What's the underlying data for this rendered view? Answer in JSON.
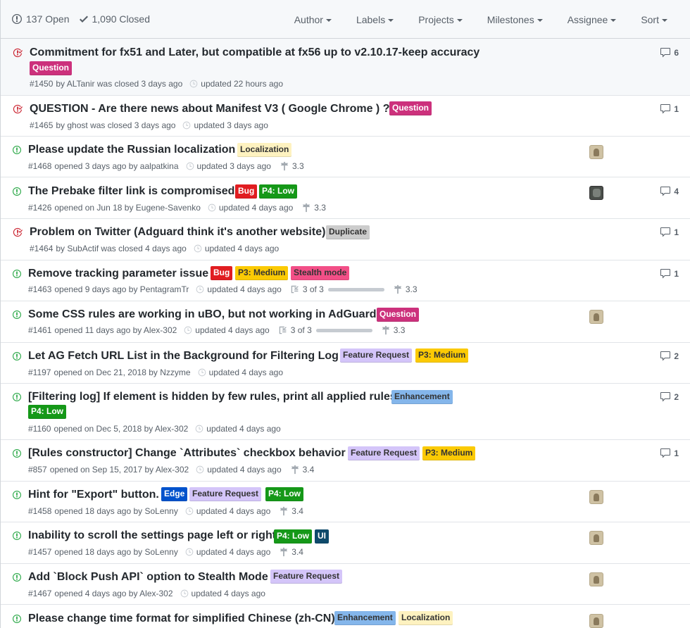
{
  "header": {
    "open_label": "137 Open",
    "closed_label": "1,090 Closed",
    "filters": [
      "Author",
      "Labels",
      "Projects",
      "Milestones",
      "Assignee",
      "Sort"
    ]
  },
  "colors": {
    "open_icon": "#28a745",
    "closed_icon": "#cb2431",
    "meta_text": "#586069"
  },
  "issues": [
    {
      "title": "Commitment for fx51 and Later, but compatible at fx56 up to v2.10.17-keep accuracy",
      "labels": [
        {
          "name": "Question",
          "bg": "#cc317c",
          "fg": "#ffffff"
        }
      ],
      "number": "#1450",
      "meta_main": "by ALTanir was closed 3 days ago",
      "updated": "updated 22 hours ago",
      "comments": "6",
      "status": "closed"
    },
    {
      "title": "QUESTION - Are there news about Manifest V3 ( Google Chrome ) ?",
      "labels": [
        {
          "name": "Question",
          "bg": "#cc317c",
          "fg": "#ffffff"
        }
      ],
      "number": "#1465",
      "meta_main": "by ghost was closed 3 days ago",
      "updated": "updated 3 days ago",
      "comments": "1",
      "status": "closed"
    },
    {
      "title": "Please update the Russian localization",
      "labels": [
        {
          "name": "Localization",
          "bg": "#fef2c0",
          "fg": "#333333"
        }
      ],
      "number": "#1468",
      "meta_main": "opened 3 days ago by aalpatkina",
      "updated": "updated 3 days ago",
      "milestone": "3.3",
      "avatar": "light",
      "status": "open"
    },
    {
      "title": "The Prebake filter link is compromised",
      "labels": [
        {
          "name": "Bug",
          "bg": "#e11d21",
          "fg": "#ffffff"
        },
        {
          "name": "P4: Low",
          "bg": "#159818",
          "fg": "#ffffff"
        }
      ],
      "number": "#1426",
      "meta_main": "opened on Jun 18 by Eugene-Savenko",
      "updated": "updated 4 days ago",
      "milestone": "3.3",
      "comments": "4",
      "avatar": "dark",
      "status": "open"
    },
    {
      "title": "Problem on Twitter (Adguard think it's another website)",
      "labels": [
        {
          "name": "Duplicate",
          "bg": "#cccccc",
          "fg": "#333333"
        }
      ],
      "number": "#1464",
      "meta_main": "by SubActif was closed 4 days ago",
      "updated": "updated 4 days ago",
      "comments": "1",
      "status": "closed"
    },
    {
      "title": "Remove tracking parameter issue",
      "labels": [
        {
          "name": "Bug",
          "bg": "#e11d21",
          "fg": "#ffffff"
        },
        {
          "name": "P3: Medium",
          "bg": "#fbca04",
          "fg": "#333333"
        },
        {
          "name": "Stealth mode",
          "bg": "#f24f87",
          "fg": "#333333"
        }
      ],
      "number": "#1463",
      "meta_main": "opened 9 days ago by PentagramTr",
      "updated": "updated 4 days ago",
      "tasks": "3 of 3",
      "task_progress": 1,
      "milestone": "3.3",
      "comments": "1",
      "status": "open"
    },
    {
      "title": "Some CSS rules are working in uBO, but not working in AdGuard",
      "labels": [
        {
          "name": "Question",
          "bg": "#cc317c",
          "fg": "#ffffff"
        }
      ],
      "number": "#1461",
      "meta_main": "opened 11 days ago by Alex-302",
      "updated": "updated 4 days ago",
      "tasks": "3 of 3",
      "task_progress": 1,
      "milestone": "3.3",
      "avatar": "light",
      "status": "open"
    },
    {
      "title": "Let AG Fetch URL List in the Background for Filtering Log",
      "labels": [
        {
          "name": "Feature Request",
          "bg": "#d4c5f9",
          "fg": "#333333"
        },
        {
          "name": "P3: Medium",
          "bg": "#fbca04",
          "fg": "#333333"
        }
      ],
      "number": "#1197",
      "meta_main": "opened on Dec 21, 2018 by Nzzyme",
      "updated": "updated 4 days ago",
      "comments": "2",
      "status": "open"
    },
    {
      "title": "[Filtering log] If element is hidden by few rules, print all applied rules",
      "labels": [
        {
          "name": "Enhancement",
          "bg": "#84b6eb",
          "fg": "#333333"
        },
        {
          "name": "P4: Low",
          "bg": "#159818",
          "fg": "#ffffff"
        }
      ],
      "number": "#1160",
      "meta_main": "opened on Dec 5, 2018 by Alex-302",
      "updated": "updated 4 days ago",
      "comments": "2",
      "status": "open"
    },
    {
      "title": "[Rules constructor] Change `Attributes` checkbox behavior",
      "labels": [
        {
          "name": "Feature Request",
          "bg": "#d4c5f9",
          "fg": "#333333"
        },
        {
          "name": "P3: Medium",
          "bg": "#fbca04",
          "fg": "#333333"
        }
      ],
      "number": "#857",
      "meta_main": "opened on Sep 15, 2017 by Alex-302",
      "updated": "updated 4 days ago",
      "milestone": "3.4",
      "comments": "1",
      "status": "open"
    },
    {
      "title": "Hint for \"Export\" button.",
      "labels": [
        {
          "name": "Edge",
          "bg": "#0052cc",
          "fg": "#ffffff"
        },
        {
          "name": "Feature Request",
          "bg": "#d4c5f9",
          "fg": "#333333"
        },
        {
          "name": "P4: Low",
          "bg": "#159818",
          "fg": "#ffffff"
        }
      ],
      "number": "#1458",
      "meta_main": "opened 18 days ago by SoLenny",
      "updated": "updated 4 days ago",
      "milestone": "3.4",
      "avatar": "light",
      "status": "open"
    },
    {
      "title": "Inability to scroll the settings page left or right",
      "labels": [
        {
          "name": "P4: Low",
          "bg": "#159818",
          "fg": "#ffffff"
        },
        {
          "name": "UI",
          "bg": "#0e4a6b",
          "fg": "#ffffff"
        }
      ],
      "number": "#1457",
      "meta_main": "opened 18 days ago by SoLenny",
      "updated": "updated 4 days ago",
      "milestone": "3.4",
      "avatar": "light",
      "status": "open"
    },
    {
      "title": "Add `Block Push API` option to Stealth Mode",
      "labels": [
        {
          "name": "Feature Request",
          "bg": "#d4c5f9",
          "fg": "#333333"
        }
      ],
      "number": "#1467",
      "meta_main": "opened 4 days ago by Alex-302",
      "updated": "updated 4 days ago",
      "avatar": "light",
      "status": "open"
    },
    {
      "title": "Please change time format for simplified Chinese (zh-CN)",
      "labels": [
        {
          "name": "Enhancement",
          "bg": "#84b6eb",
          "fg": "#333333"
        },
        {
          "name": "Localization",
          "bg": "#fef2c0",
          "fg": "#333333"
        }
      ],
      "avatar": "light",
      "status": "open"
    }
  ]
}
